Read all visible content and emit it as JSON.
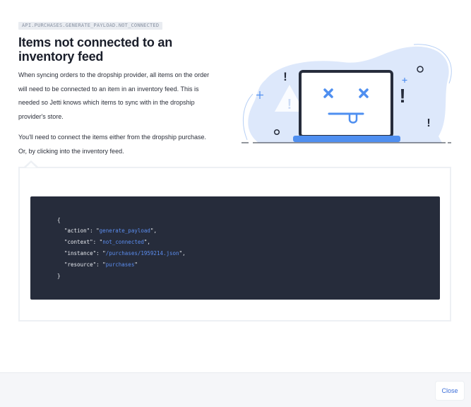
{
  "code_tag": "API.PURCHASES.GENERATE_PAYLOAD.NOT_CONNECTED",
  "title": "Items not connected to an inventory feed",
  "description": {
    "paragraph1_lines": [
      "When syncing orders to the dropship provider, all items on the order",
      "will need to be connected to an item in an inventory feed. This is",
      "needed so Jetti knows which items to sync with in the dropship",
      "provider's store."
    ],
    "paragraph2_lines": [
      "You'll need to connect the items either from the dropship purchase.",
      "Or, by clicking into the inventory feed."
    ]
  },
  "code": {
    "open_brace": "{",
    "close_brace": "}",
    "entries": [
      {
        "key": "\"action\"",
        "value": "generate_payload",
        "trailing": ","
      },
      {
        "key": "\"context\"",
        "value": "not_connected",
        "trailing": ","
      },
      {
        "key": "\"instance\"",
        "value": "/purchases/1959214.json",
        "trailing": ","
      },
      {
        "key": "\"resource\"",
        "value": "purchases",
        "trailing": ""
      }
    ]
  },
  "footer": {
    "close_label": "Close"
  },
  "colors": {
    "accent": "#3d6fd9",
    "code_background": "#262c3b",
    "code_string": "#5b8def",
    "illustration_blob": "#dce8fb",
    "illustration_blue": "#4f8ff0"
  },
  "icons": [
    "laptop-dead-illustration",
    "exclamation-icon",
    "sparkle-icon"
  ]
}
